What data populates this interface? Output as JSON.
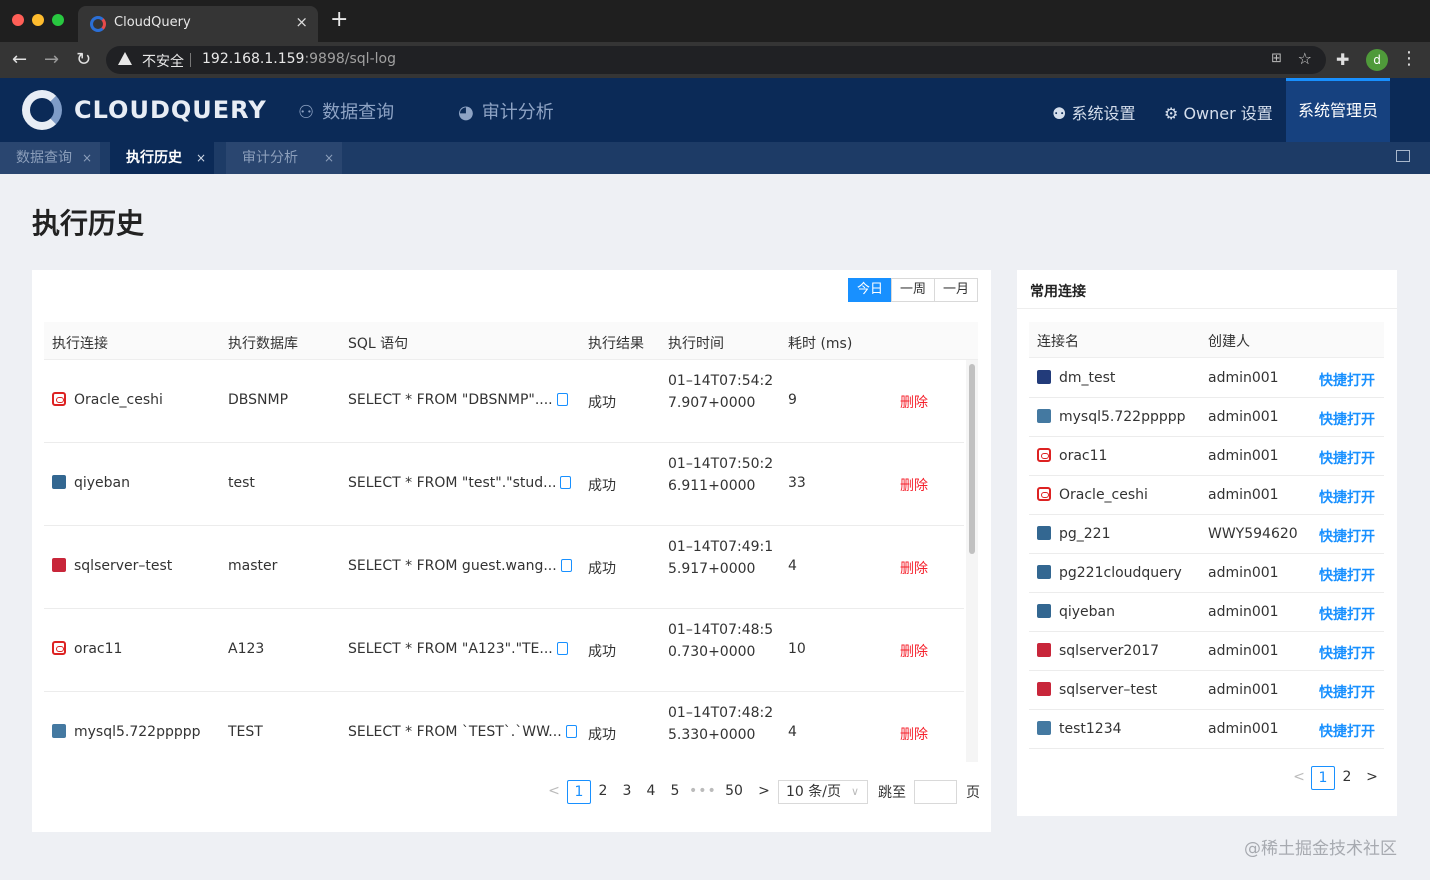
{
  "browser": {
    "tab_title": "CloudQuery",
    "tab_close": "×",
    "new_tab": "+",
    "security_label": "不安全",
    "url_host": "192.168.1.159",
    "url_rest": ":9898/sql-log",
    "icons": [
      "back-arrow-icon",
      "forward-arrow-icon",
      "reload-icon",
      "warning-icon",
      "translate-icon",
      "star-icon",
      "extensions-icon",
      "kebab-menu-icon"
    ],
    "profile_initial": "d"
  },
  "app": {
    "logo_text": "CLOUDQUERY",
    "nav": [
      {
        "label": "数据查询",
        "icon": "data-query-icon"
      },
      {
        "label": "审计分析",
        "icon": "pie-chart-icon"
      }
    ],
    "nav_right": {
      "system_settings": "系统设置",
      "owner_settings": "Owner 设置",
      "admin": "系统管理员"
    },
    "accent": "#1890ff",
    "header_bg": "#0b2a57"
  },
  "page_tabs": [
    {
      "label": "数据查询",
      "close": "×"
    },
    {
      "label": "执行历史",
      "close": "×"
    },
    {
      "label": "审计分析",
      "close": "×"
    }
  ],
  "page_title": "执行历史",
  "history": {
    "range_buttons": [
      "今日",
      "一周",
      "一月"
    ],
    "active_range": "今日",
    "columns": [
      "执行连接",
      "执行数据库",
      "SQL 语句",
      "执行结果",
      "执行时间",
      "耗时 (ms)"
    ],
    "rows": [
      {
        "conn": "Oracle_ceshi",
        "conn_type": "oracle",
        "db": "DBSNMP",
        "sql": "SELECT * FROM \"DBSNMP\"....",
        "result": "成功",
        "time": "01–14T07:54:27.907+0000",
        "cost": "9",
        "action": "删除"
      },
      {
        "conn": "qiyeban",
        "conn_type": "postgresql",
        "db": "test",
        "sql": "SELECT * FROM \"test\".\"stud...",
        "result": "成功",
        "time": "01–14T07:50:26.911+0000",
        "cost": "33",
        "action": "删除"
      },
      {
        "conn": "sqlserver–test",
        "conn_type": "sqlserver",
        "db": "master",
        "sql": "SELECT * FROM guest.wang...",
        "result": "成功",
        "time": "01–14T07:49:15.917+0000",
        "cost": "4",
        "action": "删除"
      },
      {
        "conn": "orac11",
        "conn_type": "oracle",
        "db": "A123",
        "sql": "SELECT * FROM \"A123\".\"TE...",
        "result": "成功",
        "time": "01–14T07:48:50.730+0000",
        "cost": "10",
        "action": "删除"
      },
      {
        "conn": "mysql5.722ppppp",
        "conn_type": "mysql",
        "db": "TEST",
        "sql": "SELECT * FROM `TEST`.`WW...",
        "result": "成功",
        "time": "01–14T07:48:25.330+0000",
        "cost": "4",
        "action": "删除"
      }
    ],
    "pagination": {
      "prev": "<",
      "pages": [
        "1",
        "2",
        "3",
        "4",
        "5"
      ],
      "ellipsis": "•••",
      "last": "50",
      "next": ">",
      "current": "1",
      "page_size": "10 条/页",
      "jump_label": "跳至",
      "jump_suffix": "页"
    }
  },
  "frequent": {
    "title": "常用连接",
    "columns": [
      "连接名",
      "创建人"
    ],
    "rows": [
      {
        "name": "dm_test",
        "type": "dm",
        "creator": "admin001",
        "action": "快捷打开"
      },
      {
        "name": "mysql5.722ppppp",
        "type": "mysql",
        "creator": "admin001",
        "action": "快捷打开"
      },
      {
        "name": "orac11",
        "type": "oracle",
        "creator": "admin001",
        "action": "快捷打开"
      },
      {
        "name": "Oracle_ceshi",
        "type": "oracle",
        "creator": "admin001",
        "action": "快捷打开"
      },
      {
        "name": "pg_221",
        "type": "postgresql",
        "creator": "WWY594620",
        "action": "快捷打开"
      },
      {
        "name": "pg221cloudquery",
        "type": "postgresql",
        "creator": "admin001",
        "action": "快捷打开"
      },
      {
        "name": "qiyeban",
        "type": "postgresql",
        "creator": "admin001",
        "action": "快捷打开"
      },
      {
        "name": "sqlserver2017",
        "type": "sqlserver",
        "creator": "admin001",
        "action": "快捷打开"
      },
      {
        "name": "sqlserver–test",
        "type": "sqlserver",
        "creator": "admin001",
        "action": "快捷打开"
      },
      {
        "name": "test1234",
        "type": "mysql",
        "creator": "admin001",
        "action": "快捷打开"
      }
    ],
    "pagination": {
      "prev": "<",
      "pages": [
        "1",
        "2"
      ],
      "current": "1",
      "next": ">"
    }
  },
  "watermark": "@稀土掘金技术社区"
}
